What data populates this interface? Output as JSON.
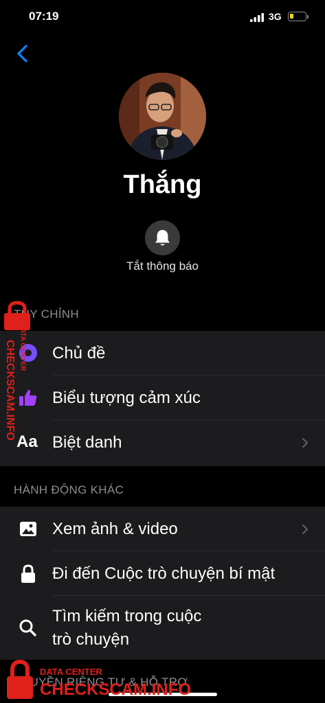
{
  "status_bar": {
    "time": "07:19",
    "network": "3G",
    "battery_level": 0.2
  },
  "profile": {
    "name": "Thắng"
  },
  "mute_button": {
    "label": "Tắt thông báo",
    "icon": "bell-icon"
  },
  "sections": {
    "customize": {
      "header": "TÙY CHỈNH"
    },
    "more_actions": {
      "header": "HÀNH ĐỘNG KHÁC"
    },
    "privacy": {
      "header": "QUYỀN RIÊNG TƯ & HỖ TRỢ"
    }
  },
  "customize_items": [
    {
      "label": "Chủ đề",
      "icon": "theme-icon"
    },
    {
      "label": "Biểu tượng cảm xúc",
      "icon": "thumbs-up-icon"
    },
    {
      "label": "Biệt danh",
      "icon": "font-aa-icon",
      "icon_text": "Aa"
    }
  ],
  "action_items": [
    {
      "label": "Xem ảnh & video",
      "icon": "image-icon"
    },
    {
      "label": "Đi đến Cuộc trò chuyện bí mật",
      "icon": "lock-icon"
    },
    {
      "label_line1": "Tìm kiếm trong cuộc",
      "label_line2": "trò chuyện",
      "icon": "search-icon"
    }
  ],
  "watermark": {
    "side_text": "CHECKSCAM.INFO",
    "small_text": "DATA CENTER",
    "bottom_small": "DATA CENTER",
    "bottom_big": "CHECKSCAM.INFO"
  },
  "colors": {
    "accent": "#0a84ff",
    "theme_icon": "#8a5cff",
    "thumb_icon": "#a33fff",
    "watermark": "#e0201a"
  }
}
